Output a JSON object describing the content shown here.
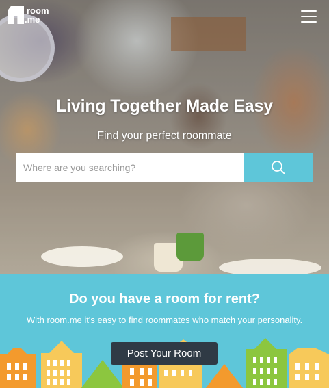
{
  "brand": {
    "line1": "room",
    "line2": ".me"
  },
  "nav": {
    "menu_icon": "hamburger-menu-icon"
  },
  "hero": {
    "title": "Living Together Made Easy",
    "subtitle": "Find your perfect roommate",
    "search_placeholder": "Where are you searching?",
    "search_icon": "search-icon"
  },
  "promo": {
    "title": "Do you have a room for rent?",
    "text": "With room.me it's easy to find roommates who match your personality.",
    "button_label": "Post Your Room"
  },
  "colors": {
    "accent": "#5ec6d9",
    "button_dark": "#2f3a45",
    "building_orange": "#f39a2d",
    "building_yellow": "#f7c95a",
    "building_green": "#8cc63f"
  }
}
